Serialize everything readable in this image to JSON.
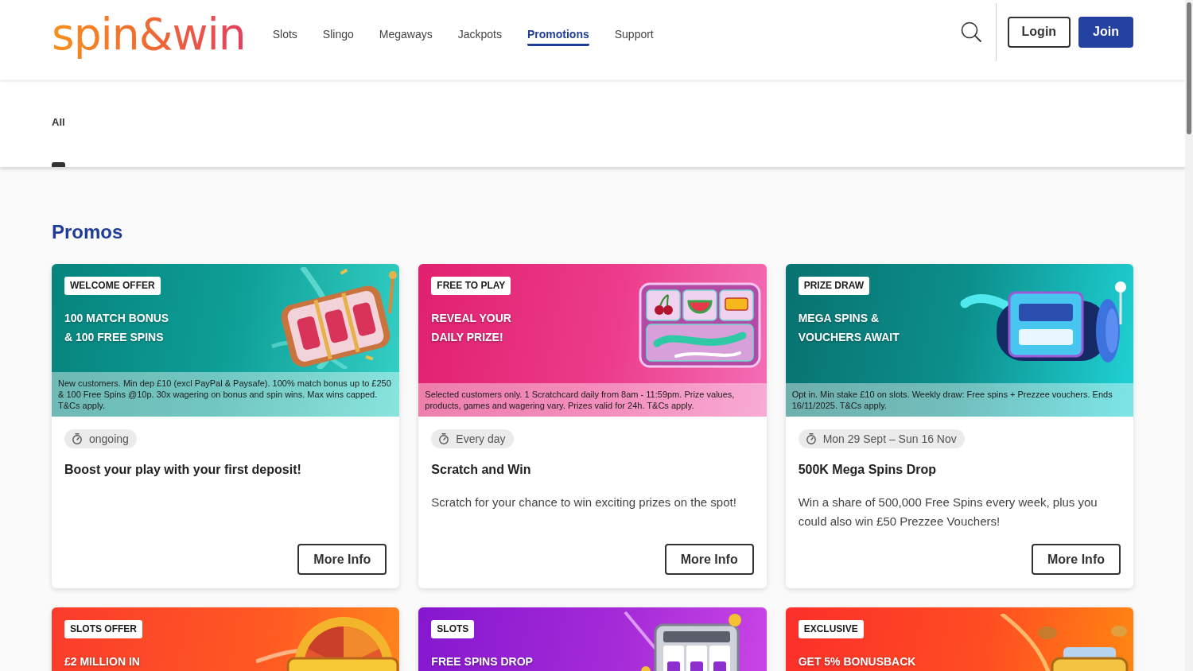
{
  "header": {
    "logo": "spin&win",
    "nav": [
      {
        "label": "Slots",
        "selected": false
      },
      {
        "label": "Slingo",
        "selected": false
      },
      {
        "label": "Megaways",
        "selected": false
      },
      {
        "label": "Jackpots",
        "selected": false
      },
      {
        "label": "Promotions",
        "selected": true
      },
      {
        "label": "Support",
        "selected": false
      }
    ],
    "buttons": [
      {
        "label": "Login",
        "kind": "outline"
      },
      {
        "label": "Join",
        "kind": "primary"
      }
    ]
  },
  "filters": [
    {
      "label": "All",
      "selected": true
    }
  ],
  "section": {
    "title": "Promos"
  },
  "promos": [
    {
      "kind": "reels",
      "tag": "WELCOME OFFER",
      "headline": [
        "100 MATCH BONUS",
        "& 100 FREE SPINS"
      ],
      "terms": "New customers. Min dep £10 (excl PayPal & Paysafe). 100% match bonus up to £250 & 100 Free Spins @10p. 30x wagering on bonus and spin wins. Max wins capped. T&Cs apply.",
      "period": "ongoing",
      "title": "Boost your play with your first deposit!",
      "button": "More Info"
    },
    {
      "kind": "scratchcard",
      "tag": "FREE TO PLAY",
      "headline": [
        "REVEAL YOUR",
        "DAILY PRIZE!"
      ],
      "terms": "Selected customers only. 1 Scratchcard daily from 8am - 11:59pm. Prize values, products, games and wagering vary. Prizes valid for 24h. T&Cs apply.",
      "period": "Every day",
      "title": "Scratch and Win",
      "description": "Scratch for your chance to win exciting prizes on the spot!",
      "button": "More Info"
    },
    {
      "kind": "spin-drop",
      "tag": "PRIZE DRAW",
      "headline": [
        "MEGA SPINS &",
        "VOUCHERS AWAIT"
      ],
      "terms": "Opt in. Min stake £10 on slots. Weekly draw: Free spins + Prezzee vouchers. Ends 16/11/2025. T&Cs apply.",
      "period": "Mon 29 Sept – Sun 16 Nov",
      "title": "500K Mega Spins Drop",
      "description": "Win a share of 500,000 Free Spins every week, plus you could also win £50 Prezzee Vouchers!",
      "button": "More Info"
    },
    {
      "kind": "prize-wheel",
      "tag": "SLOTS OFFER",
      "headline": [
        "£2 MILLION IN"
      ]
    },
    {
      "kind": "slot-machine",
      "tag": "SLOTS",
      "headline": [
        "FREE SPINS DROP"
      ]
    },
    {
      "kind": "bonus-coins",
      "tag": "EXCLUSIVE",
      "headline": [
        "GET 5% BONUSBACK"
      ]
    }
  ]
}
